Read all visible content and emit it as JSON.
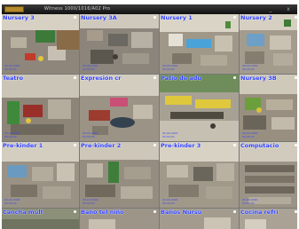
{
  "window": {
    "title": "Witness 1000/1016/A02 Pro",
    "minimize_glyph": "_",
    "close_glyph": "x"
  },
  "cameras": [
    {
      "label": "Nursery 3",
      "time": "00-00-0000\n00:00:00"
    },
    {
      "label": "Nursery 3A",
      "time": "00-00-0000\n00:00:00"
    },
    {
      "label": "Nursery 1",
      "time": "00-00-0000\n00:00:00"
    },
    {
      "label": "Nursery 2",
      "time": "00-00-0000\n00:00:00"
    },
    {
      "label": "Teatro",
      "time": "00-00-0000\n00:00:00"
    },
    {
      "label": "Expresión cr",
      "time": "00-00-0000\n00:00:00"
    },
    {
      "label": "Patio de adu",
      "time": "00-00-0000\n00:00:00"
    },
    {
      "label": "Nursery 3B",
      "time": "00-00-0000\n00:00:00"
    },
    {
      "label": "Pre-kinder 1",
      "time": "00-00-0000\n00:00:00"
    },
    {
      "label": "Pre-kinder 2",
      "time": "00-00-0000\n00:00:00"
    },
    {
      "label": "Pre-kinder 3",
      "time": "00-00-0000\n00:00:00"
    },
    {
      "label": "Computacio",
      "time": "00-00-0000\n00:00:00"
    },
    {
      "label": "Cancha mult",
      "time": ""
    },
    {
      "label": "Baño tel niño",
      "time": ""
    },
    {
      "label": "Baños Nursu",
      "time": ""
    },
    {
      "label": "Cocina refri",
      "time": ""
    }
  ]
}
